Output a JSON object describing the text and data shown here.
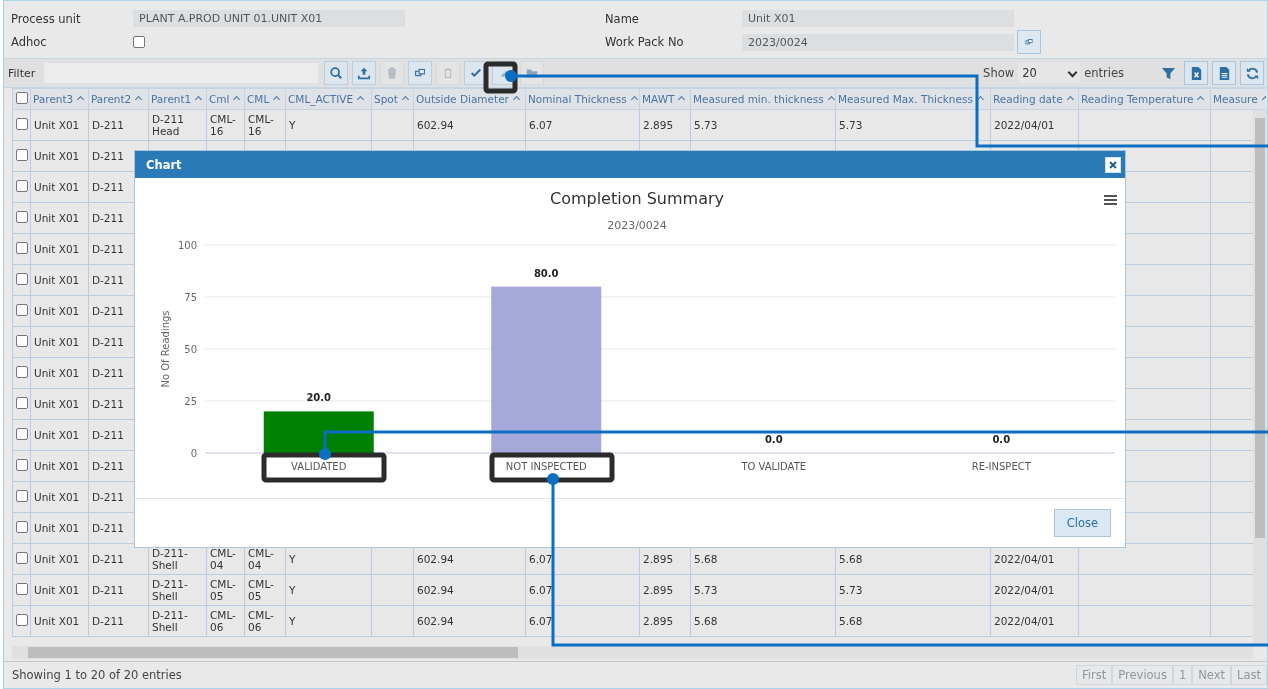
{
  "form": {
    "process_unit": {
      "label": "Process unit",
      "value": "PLANT A.PROD UNIT 01.UNIT X01"
    },
    "name": {
      "label": "Name",
      "value": "Unit X01"
    },
    "adhoc": {
      "label": "Adhoc",
      "checked": false
    },
    "work_pack": {
      "label": "Work Pack No",
      "value": "2023/0024"
    }
  },
  "filter": {
    "label": "Filter"
  },
  "toolbar": [
    {
      "kind": "search",
      "disabled": false
    },
    {
      "kind": "upload",
      "disabled": false
    },
    {
      "kind": "trash",
      "disabled": true
    },
    {
      "kind": "copy",
      "disabled": false
    },
    {
      "kind": "clipboard",
      "disabled": true
    },
    {
      "kind": "check",
      "disabled": false
    },
    {
      "kind": "chart",
      "disabled": false
    },
    {
      "kind": "folder",
      "disabled": true
    }
  ],
  "show": {
    "label": "Show",
    "value": "20",
    "suffix": "entries"
  },
  "right_tools": [
    {
      "kind": "filter"
    },
    {
      "kind": "excel"
    },
    {
      "kind": "document"
    },
    {
      "kind": "refresh"
    }
  ],
  "table": {
    "all_checked": false,
    "columns": [
      "Parent3",
      "Parent2",
      "Parent1",
      "Cml",
      "CML",
      "CML_ACTIVE",
      "Spot",
      "Outside Diameter",
      "Nominal Thickness",
      "MAWT",
      "Measured min. thickness",
      "Measured Max. Thickness",
      "Reading date",
      "Reading Temperature",
      "Measure"
    ],
    "rows": [
      {
        "checked": false,
        "cells": [
          "Unit X01",
          "D-211",
          "D-211 Head",
          "CML-16",
          "CML-16",
          "Y",
          "",
          "602.94",
          "6.07",
          "2.895",
          "5.73",
          "5.73",
          "2022/04/01"
        ]
      },
      {
        "checked": false,
        "cells": [
          "Unit X01",
          "D-211"
        ]
      },
      {
        "checked": false,
        "cells": [
          "Unit X01",
          "D-211"
        ]
      },
      {
        "checked": false,
        "cells": [
          "Unit X01",
          "D-211"
        ]
      },
      {
        "checked": false,
        "cells": [
          "Unit X01",
          "D-211"
        ]
      },
      {
        "checked": false,
        "cells": [
          "Unit X01",
          "D-211"
        ]
      },
      {
        "checked": false,
        "cells": [
          "Unit X01",
          "D-211"
        ]
      },
      {
        "checked": false,
        "cells": [
          "Unit X01",
          "D-211"
        ]
      },
      {
        "checked": false,
        "cells": [
          "Unit X01",
          "D-211"
        ]
      },
      {
        "checked": false,
        "cells": [
          "Unit X01",
          "D-211"
        ]
      },
      {
        "checked": false,
        "cells": [
          "Unit X01",
          "D-211"
        ]
      },
      {
        "checked": false,
        "cells": [
          "Unit X01",
          "D-211"
        ]
      },
      {
        "checked": false,
        "cells": [
          "Unit X01",
          "D-211"
        ]
      },
      {
        "checked": false,
        "cells": [
          "Unit X01",
          "D-211"
        ]
      },
      {
        "checked": false,
        "cells": [
          "Unit X01",
          "D-211",
          "D-211-Shell",
          "CML-04",
          "CML-04",
          "Y",
          "",
          "602.94",
          "6.07",
          "2.895",
          "5.68",
          "5.68",
          "2022/04/01"
        ]
      },
      {
        "checked": false,
        "cells": [
          "Unit X01",
          "D-211",
          "D-211-Shell",
          "CML-05",
          "CML-05",
          "Y",
          "",
          "602.94",
          "6.07",
          "2.895",
          "5.73",
          "5.73",
          "2022/04/01"
        ]
      },
      {
        "checked": false,
        "cells": [
          "Unit X01",
          "D-211",
          "D-211-Shell",
          "CML-06",
          "CML-06",
          "Y",
          "",
          "602.94",
          "6.07",
          "2.895",
          "5.68",
          "5.68",
          "2022/04/01"
        ]
      }
    ]
  },
  "status": "Showing 1 to 20 of 20 entries",
  "pager": [
    {
      "label": "First",
      "disabled": true
    },
    {
      "label": "Previous",
      "disabled": true
    },
    {
      "label": "1",
      "disabled": true
    },
    {
      "label": "Next",
      "disabled": true
    },
    {
      "label": "Last",
      "disabled": true
    }
  ],
  "dialog": {
    "title": "Chart",
    "close_label": "Close",
    "chart_data": {
      "type": "bar",
      "title": "Completion Summary",
      "subtitle": "2023/0024",
      "ylabel": "No Of Readings",
      "categories": [
        "VALIDATED",
        "NOT INSPECTED",
        "TO VALIDATE",
        "RE-INSPECT"
      ],
      "series": [
        {
          "values": [
            20,
            80,
            0,
            0
          ],
          "colors": [
            "#008000",
            "#a5a8d9",
            null,
            null
          ]
        }
      ],
      "value_labels": [
        "20.0",
        "80.0",
        "0.0",
        "0.0"
      ],
      "ylim": [
        0,
        100
      ],
      "yticks": [
        0,
        25,
        50,
        75,
        100
      ],
      "grid": true
    }
  }
}
